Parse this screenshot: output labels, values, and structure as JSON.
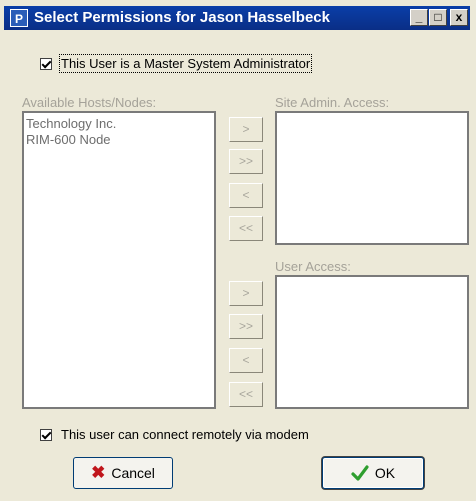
{
  "window": {
    "title": "Select Permissions for Jason Hasselbeck",
    "icon_glyph": "P",
    "controls": [
      "_",
      "□",
      "x"
    ]
  },
  "master_admin": {
    "label": "This User is a Master System Administrator",
    "checked": true
  },
  "available": {
    "label": "Available Hosts/Nodes:",
    "items": [
      "Technology Inc.",
      "RIM-600 Node"
    ]
  },
  "site_admin": {
    "label": "Site Admin. Access:",
    "items": []
  },
  "user_access": {
    "label": "User Access:",
    "items": []
  },
  "move_buttons": [
    ">",
    ">>",
    "<",
    "<<"
  ],
  "modem": {
    "label": "This user can connect remotely via modem",
    "checked": true
  },
  "buttons": {
    "cancel": "Cancel",
    "ok": "OK"
  },
  "colors": {
    "title_bar": "#0a3ea8",
    "dialog_bg": "#ece9d8",
    "cancel_icon": "#c0151b",
    "ok_icon": "#2e9e2e"
  }
}
